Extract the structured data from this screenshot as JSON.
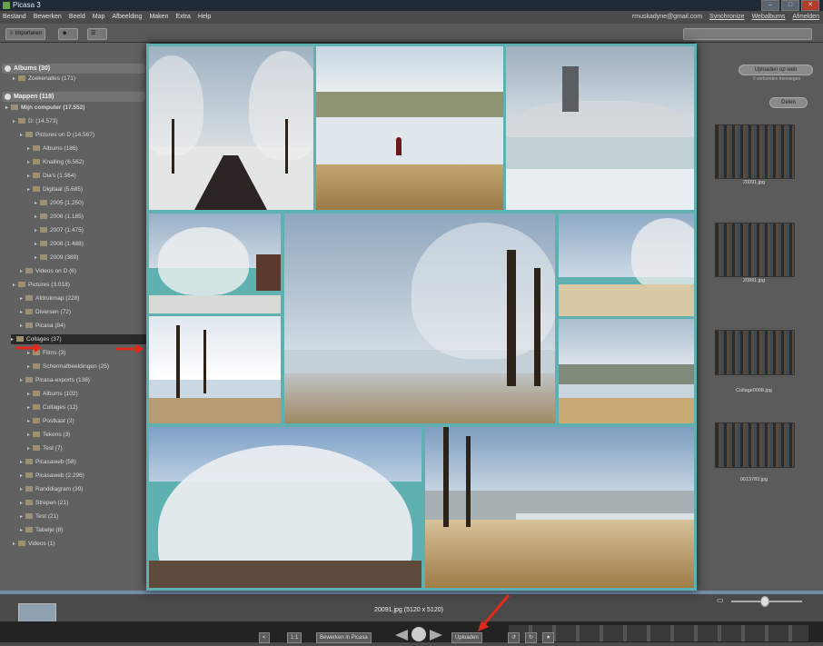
{
  "window": {
    "title": "Picasa 3"
  },
  "menubar": {
    "menus": [
      "Bestand",
      "Bewerken",
      "Beeld",
      "Map",
      "Afbeelding",
      "Maken",
      "Extra",
      "Help"
    ],
    "email": "rmuskadyne@gmail.com",
    "links": [
      "Synchronize",
      "Webalbums",
      "Afmelden"
    ]
  },
  "toolbar": {
    "import_label": "Importeren"
  },
  "sidebar": {
    "sections": [
      {
        "label": "Albums (30)"
      },
      {
        "label": "Mappen (118)"
      }
    ],
    "items": [
      {
        "label": "Zoekenalles (171)",
        "indent": 1
      },
      {
        "label": "Mijn computer (17.552)",
        "indent": 0,
        "bold": true
      },
      {
        "label": "D: (14.573)",
        "indent": 1
      },
      {
        "label": "Pictures on D (14.567)",
        "indent": 2
      },
      {
        "label": "Albums (186)",
        "indent": 3
      },
      {
        "label": "Knalling (6.562)",
        "indent": 3
      },
      {
        "label": "Dia's (1.564)",
        "indent": 3
      },
      {
        "label": "Digitaal (5.685)",
        "indent": 3
      },
      {
        "label": "2005 (1.250)",
        "indent": 4
      },
      {
        "label": "2006 (1.185)",
        "indent": 4
      },
      {
        "label": "2007 (1.475)",
        "indent": 4
      },
      {
        "label": "2008 (1.488)",
        "indent": 4
      },
      {
        "label": "2009 (389)",
        "indent": 4
      },
      {
        "label": "Videos on D (6)",
        "indent": 2
      },
      {
        "label": "Pictures (3.018)",
        "indent": 1
      },
      {
        "label": "Afdrukmap (228)",
        "indent": 2
      },
      {
        "label": "Diversen (72)",
        "indent": 2
      },
      {
        "label": "Picasa (84)",
        "indent": 2
      },
      {
        "label": "Collages (37)",
        "indent": 3,
        "selected": true
      },
      {
        "label": "Films (3)",
        "indent": 3
      },
      {
        "label": "Schermafbeeldingen (25)",
        "indent": 3
      },
      {
        "label": "Picasa-exports (138)",
        "indent": 2
      },
      {
        "label": "Albums (102)",
        "indent": 3
      },
      {
        "label": "Collages (12)",
        "indent": 3
      },
      {
        "label": "Postkast (2)",
        "indent": 3
      },
      {
        "label": "Tekens (3)",
        "indent": 3
      },
      {
        "label": "Test (7)",
        "indent": 3
      },
      {
        "label": "Picasaweb (58)",
        "indent": 2
      },
      {
        "label": "Picasaweb (2.296)",
        "indent": 2
      },
      {
        "label": "Randdiagram (39)",
        "indent": 2
      },
      {
        "label": "Strepen (21)",
        "indent": 2
      },
      {
        "label": "Test (21)",
        "indent": 2
      },
      {
        "label": "Tabelje (8)",
        "indent": 2
      },
      {
        "label": "Videos (1)",
        "indent": 1
      }
    ]
  },
  "right_panel": {
    "upload_label": "Uploaden op web",
    "upload_sub": "0 verbonden toevoegen",
    "share_label": "Delen",
    "thumbnails": [
      {
        "label": "20091.jpg"
      },
      {
        "label": "20991.jpg"
      },
      {
        "label": "Collage0008.jpg"
      },
      {
        "label": "0013783.jpg"
      }
    ]
  },
  "statusbar": {
    "file_label": "20091.jpg (5120 x 5120)",
    "prev_btn": "<",
    "page_btn": "1:1",
    "edit_btn": "Bewerken in Picasa",
    "upload_btn": "Uploaden"
  },
  "colors": {
    "collage_border": "#5fb0b1",
    "selection_arrow": "#e02a1b"
  }
}
